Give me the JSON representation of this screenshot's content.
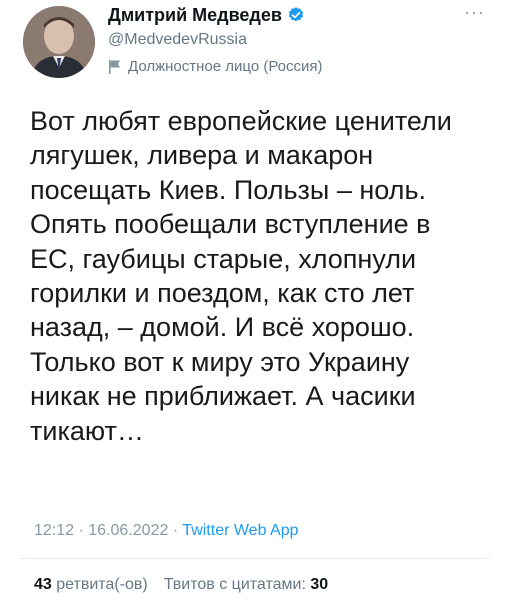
{
  "author": {
    "display_name": "Дмитрий Медведев",
    "handle": "@MedvedevRussia",
    "label": "Должностное лицо (Россия)",
    "verified_color": "#1d9bf0"
  },
  "menu": {
    "more_label": "···"
  },
  "tweet": {
    "text": "Вот любят европейские ценители\nлягушек, ливера и макарон\nпосещать Киев. Пользы – ноль.\nОпять пообещали вступление в\nЕС, гаубицы старые, хлопнули\nгорилки и поездом, как сто лет\nназад, – домой. И всё хорошо.\nТолько вот к миру это Украину\nникак не приближает. А часики\nтикают…",
    "time": "12:12",
    "separator": "·",
    "date": "16.06.2022",
    "source": "Twitter Web App"
  },
  "stats": {
    "retweets_count": "43",
    "retweets_label": "ретвита(-ов)",
    "quotes_label": "Твитов с цитатами:",
    "quotes_count": "30"
  }
}
